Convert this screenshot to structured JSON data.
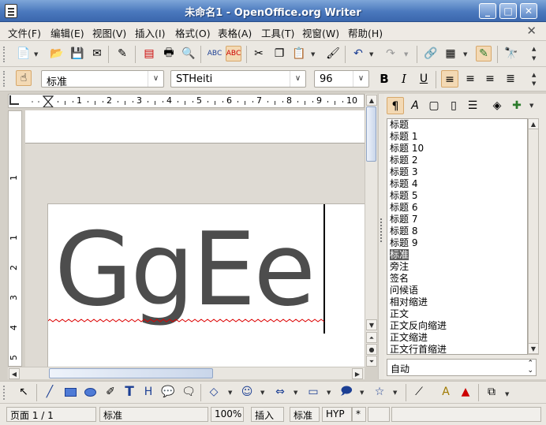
{
  "window": {
    "title": "未命名1 - OpenOffice.org Writer"
  },
  "menu": [
    {
      "label": "文件(F)"
    },
    {
      "label": "编辑(E)"
    },
    {
      "label": "视图(V)"
    },
    {
      "label": "插入(I)"
    },
    {
      "label": "格式(O)"
    },
    {
      "label": "表格(A)"
    },
    {
      "label": "工具(T)"
    },
    {
      "label": "视窗(W)"
    },
    {
      "label": "帮助(H)"
    }
  ],
  "formatting": {
    "paragraph_style": "标准",
    "font_name": "STHeiti",
    "font_size": "96",
    "bold_label": "B",
    "italic_label": "I",
    "underline_label": "U"
  },
  "ruler": {
    "numbers": [
      "1",
      "2",
      "3",
      "4",
      "5",
      "6",
      "7",
      "8",
      "9",
      "10"
    ],
    "vnumbers": [
      "1",
      "1",
      "2",
      "3",
      "4",
      "5"
    ]
  },
  "document": {
    "text": "GgEe"
  },
  "stylist": {
    "styles": [
      "标题",
      "标题 1",
      "标题 10",
      "标题 2",
      "标题 3",
      "标题 4",
      "标题 5",
      "标题 6",
      "标题 7",
      "标题 8",
      "标题 9",
      "标准",
      "旁注",
      "签名",
      "问候语",
      "相对缩进",
      "正文",
      "正文反向缩进",
      "正文缩进",
      "正文行首缩进"
    ],
    "selected_index": 11,
    "filter": "自动"
  },
  "status": {
    "page": "页面 1 / 1",
    "page_style": "标准",
    "zoom": "100%",
    "insert_mode": "插入",
    "selection_mode": "标准",
    "hyperlink_mode": "HYP",
    "modified": "*"
  },
  "colors": {
    "accent": "#4a78bd",
    "active": "#f3d9b4",
    "text_gray": "#4d4d4d"
  }
}
